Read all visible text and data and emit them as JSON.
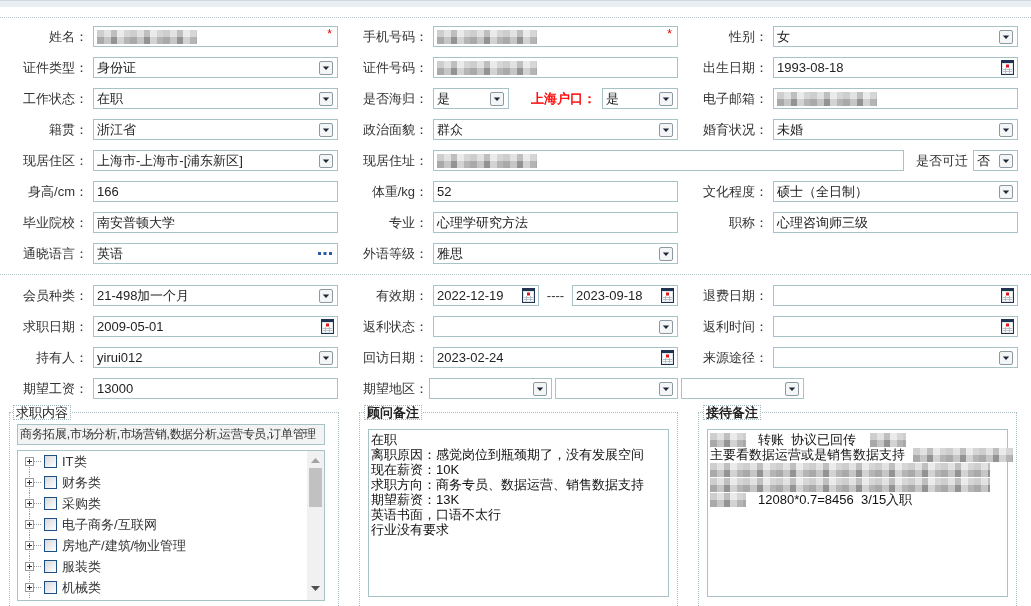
{
  "basic_info": [
    [
      {
        "kind": "single",
        "label": "姓名：",
        "controls": [
          {
            "kind": "text",
            "redacted": true,
            "required_mark": "*"
          }
        ]
      },
      {
        "kind": "single",
        "label": "手机号码：",
        "controls": [
          {
            "kind": "text",
            "redacted": true,
            "required_mark": "*"
          }
        ]
      },
      {
        "kind": "single",
        "label": "性别：",
        "controls": [
          {
            "kind": "select",
            "value": "女"
          }
        ]
      }
    ],
    [
      {
        "kind": "single",
        "label": "证件类型：",
        "controls": [
          {
            "kind": "select",
            "value": "身份证"
          }
        ]
      },
      {
        "kind": "single",
        "label": "证件号码：",
        "controls": [
          {
            "kind": "text",
            "redacted": true
          }
        ]
      },
      {
        "kind": "single",
        "label": "出生日期：",
        "controls": [
          {
            "kind": "date",
            "value": "1993-08-18"
          }
        ]
      }
    ],
    [
      {
        "kind": "single",
        "label": "工作状态：",
        "controls": [
          {
            "kind": "select",
            "value": "在职"
          }
        ]
      },
      {
        "kind": "split",
        "label": "是否海归：",
        "controls": [
          {
            "kind": "select",
            "value": "是"
          },
          {
            "kind": "select",
            "label": "上海户口：",
            "color": "#ff0000",
            "value": "是"
          }
        ]
      },
      {
        "kind": "single",
        "label": "电子邮箱：",
        "controls": [
          {
            "kind": "text",
            "redacted": true
          }
        ]
      }
    ],
    [
      {
        "kind": "single",
        "label": "籍贯：",
        "controls": [
          {
            "kind": "select",
            "value": "浙江省"
          }
        ]
      },
      {
        "kind": "single",
        "label": "政治面貌：",
        "controls": [
          {
            "kind": "select",
            "value": "群众"
          }
        ]
      },
      {
        "kind": "single",
        "label": "婚育状况：",
        "controls": [
          {
            "kind": "select",
            "value": "未婚"
          }
        ]
      }
    ],
    [
      {
        "kind": "single",
        "label": "现居住区：",
        "controls": [
          {
            "kind": "select",
            "value": "上海市-上海市-[浦东新区]"
          }
        ]
      },
      {
        "kind": "wide",
        "label": "现居住址：",
        "controls": [
          {
            "kind": "text",
            "redacted": true
          },
          {
            "kind": "select",
            "label": "是否可迁",
            "value": "否"
          }
        ]
      }
    ],
    [
      {
        "kind": "single",
        "label": "身高/cm：",
        "controls": [
          {
            "kind": "text",
            "value": "166"
          }
        ]
      },
      {
        "kind": "single",
        "label": "体重/kg：",
        "controls": [
          {
            "kind": "text",
            "value": "52"
          }
        ]
      },
      {
        "kind": "single",
        "label": "文化程度：",
        "controls": [
          {
            "kind": "select",
            "value": "硕士（全日制）"
          }
        ]
      }
    ],
    [
      {
        "kind": "single",
        "label": "毕业院校：",
        "controls": [
          {
            "kind": "text",
            "value": "南安普顿大学"
          }
        ]
      },
      {
        "kind": "single",
        "label": "专业：",
        "controls": [
          {
            "kind": "text",
            "value": "心理学研究方法"
          }
        ]
      },
      {
        "kind": "single",
        "label": "职称：",
        "controls": [
          {
            "kind": "text",
            "value": "心理咨询师三级"
          }
        ]
      }
    ],
    [
      {
        "kind": "single",
        "label": "通晓语言：",
        "controls": [
          {
            "kind": "lookup",
            "value": "英语"
          }
        ]
      },
      {
        "kind": "single",
        "label": "外语等级：",
        "controls": [
          {
            "kind": "select",
            "value": "雅思"
          }
        ]
      }
    ]
  ],
  "membership": [
    [
      {
        "kind": "single",
        "label": "会员种类：",
        "controls": [
          {
            "kind": "select",
            "value": "21-498加一个月"
          }
        ]
      },
      {
        "kind": "range",
        "label": "有效期：",
        "separator": "----",
        "controls": [
          {
            "kind": "date",
            "value": "2022-12-19"
          },
          {
            "kind": "date",
            "value": "2023-09-18"
          }
        ]
      },
      {
        "kind": "single",
        "label": "退费日期：",
        "controls": [
          {
            "kind": "date"
          }
        ]
      }
    ],
    [
      {
        "kind": "single",
        "label": "求职日期：",
        "controls": [
          {
            "kind": "date",
            "value": "2009-05-01"
          }
        ]
      },
      {
        "kind": "single",
        "label": "返利状态：",
        "controls": [
          {
            "kind": "select"
          }
        ]
      },
      {
        "kind": "single",
        "label": "返利时间：",
        "controls": [
          {
            "kind": "date"
          }
        ]
      }
    ],
    [
      {
        "kind": "single",
        "label": "持有人：",
        "controls": [
          {
            "kind": "select",
            "value": "yirui012"
          }
        ]
      },
      {
        "kind": "single",
        "label": "回访日期：",
        "controls": [
          {
            "kind": "date",
            "value": "2023-02-24"
          }
        ]
      },
      {
        "kind": "single",
        "label": "来源途径：",
        "controls": [
          {
            "kind": "select"
          }
        ]
      }
    ],
    [
      {
        "kind": "single",
        "label": "期望工资：",
        "controls": [
          {
            "kind": "text",
            "value": "13000"
          }
        ]
      },
      {
        "kind": "multi",
        "label": "期望地区：",
        "controls": [
          {
            "kind": "select"
          },
          {
            "kind": "select"
          },
          {
            "kind": "select"
          }
        ]
      }
    ]
  ],
  "panels": [
    {
      "kind": "tree",
      "legend": "求职内容",
      "emphasized": false,
      "summary": "商务拓展,市场分析,市场营销,数据分析,运营专员,订单管理",
      "categories": [
        {
          "label": "IT类",
          "expanded": false,
          "checked": false
        },
        {
          "label": "财务类",
          "expanded": false,
          "checked": false
        },
        {
          "label": "采购类",
          "expanded": false,
          "checked": false
        },
        {
          "label": "电子商务/互联网",
          "expanded": false,
          "checked": false
        },
        {
          "label": "房地产/建筑/物业管理",
          "expanded": false,
          "checked": false
        },
        {
          "label": "服装类",
          "expanded": false,
          "checked": false
        },
        {
          "label": "机械类",
          "expanded": false,
          "checked": false
        }
      ]
    },
    {
      "kind": "notes",
      "legend": "顾问备注",
      "emphasized": true,
      "lines": [
        [
          {
            "kind": "text",
            "text": "在职"
          }
        ],
        [
          {
            "kind": "text",
            "text": "离职原因：感觉岗位到瓶颈期了，没有发展空间"
          }
        ],
        [
          {
            "kind": "text",
            "text": "现在薪资：10K"
          }
        ],
        [
          {
            "kind": "text",
            "text": "求职方向：商务专员、数据运营、销售数据支持"
          }
        ],
        [
          {
            "kind": "text",
            "text": "期望薪资：13K"
          }
        ],
        [
          {
            "kind": "text",
            "text": "英语书面，口语不太行"
          }
        ],
        [
          {
            "kind": "text",
            "text": "行业没有要求"
          }
        ]
      ]
    },
    {
      "kind": "notes",
      "legend": "接待备注",
      "emphasized": true,
      "lines": [
        [
          {
            "kind": "redacted"
          },
          {
            "kind": "text",
            "text": "转账  协议已回传"
          },
          {
            "kind": "redacted"
          }
        ],
        [
          {
            "kind": "text",
            "text": "主要看数据运营或是销售数据支持"
          },
          {
            "kind": "redacted"
          }
        ],
        [
          {
            "kind": "redacted"
          }
        ],
        [
          {
            "kind": "redacted"
          }
        ],
        [
          {
            "kind": "redacted"
          },
          {
            "kind": "text",
            "text": "12080*0.7=8456  3/15入职"
          }
        ]
      ]
    }
  ]
}
